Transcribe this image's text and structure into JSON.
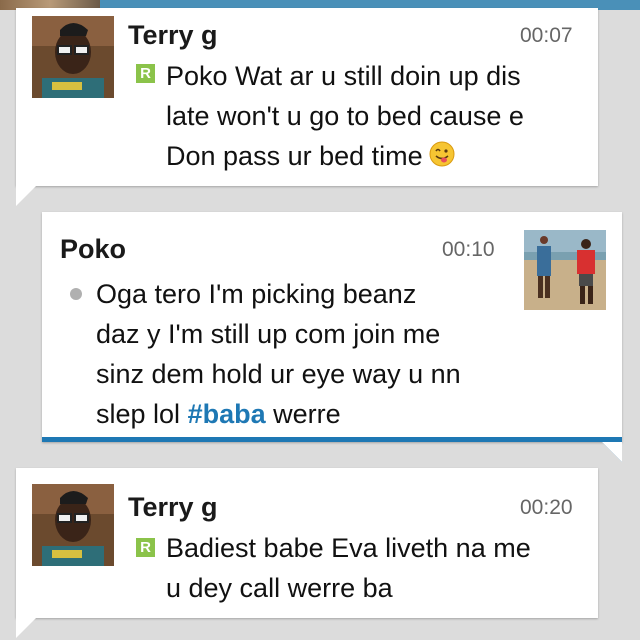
{
  "colors": {
    "background": "#dcdcdc",
    "bubble": "#ffffff",
    "accent_blue": "#1e78b4",
    "read_badge": "#8bc34a",
    "hashtag": "#1e78b4"
  },
  "messages": [
    {
      "sender": "Terry g",
      "time": "00:07",
      "status_icon": "read-badge-icon",
      "status_label": "R",
      "lines": [
        "Poko Wat ar u still doin up dis",
        "late won't u go to bed cause e",
        "Don pass ur bed time"
      ],
      "emoji": "tongue-out-smiley-icon"
    },
    {
      "sender": "Poko",
      "time": "00:10",
      "status_icon": "sent-dot-icon",
      "lines": [
        "Oga tero I'm picking beanz",
        "daz y I'm still up com join me",
        "sinz dem hold ur eye way u nn",
        "slep lol"
      ],
      "hashtag": "#baba",
      "after_hashtag": "werre"
    },
    {
      "sender": "Terry g",
      "time": "00:20",
      "status_icon": "read-badge-icon",
      "status_label": "R",
      "lines": [
        "Badiest babe Eva liveth na me",
        "u dey call werre ba"
      ]
    }
  ]
}
